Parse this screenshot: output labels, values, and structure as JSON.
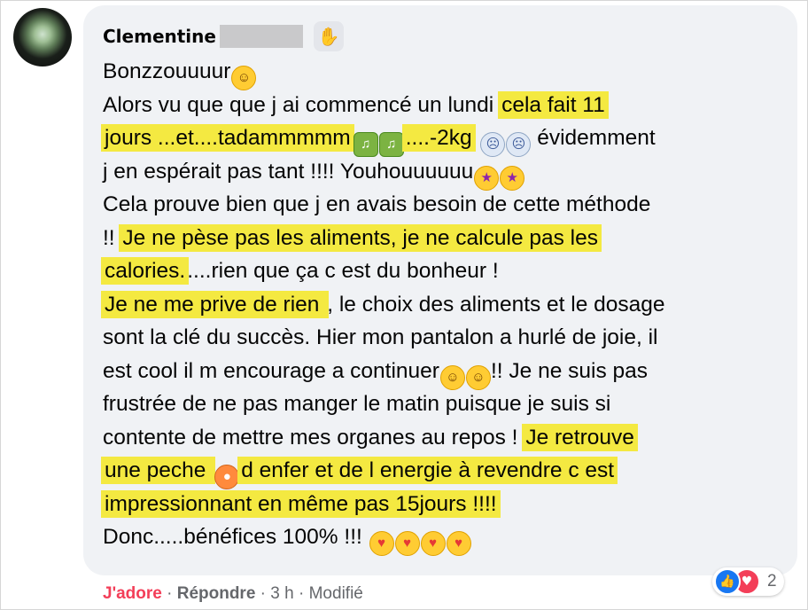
{
  "comment": {
    "author": "Clementine",
    "lines": [
      {
        "parts": [
          {
            "t": "Bonzzouuuur"
          },
          {
            "emoji": "grin"
          }
        ]
      },
      {
        "parts": [
          {
            "t": "Alors vu que que j ai commencé un lundi "
          },
          {
            "t": "cela fait 11",
            "hl": true
          }
        ]
      },
      {
        "parts": [
          {
            "t": "jours ...et....tadammmmm",
            "hl": true
          },
          {
            "emoji": "drum"
          },
          {
            "emoji": "drum"
          },
          {
            "t": "....-2kg",
            "hl": true
          },
          {
            "t": " "
          },
          {
            "emoji": "scream"
          },
          {
            "emoji": "scream"
          },
          {
            "t": " évidemment"
          }
        ]
      },
      {
        "parts": [
          {
            "t": "j en espérait pas tant !!!! Youhouuuuuu"
          },
          {
            "emoji": "star"
          },
          {
            "emoji": "star"
          }
        ]
      },
      {
        "parts": [
          {
            "t": "Cela prouve bien que j en avais besoin de cette méthode"
          }
        ]
      },
      {
        "parts": [
          {
            "t": "!! "
          },
          {
            "t": "Je ne pèse pas les aliments, je ne calcule pas les",
            "hl": true
          }
        ]
      },
      {
        "parts": [
          {
            "t": "calories.",
            "hl": true
          },
          {
            "t": "....rien que ça c est du bonheur !"
          }
        ]
      },
      {
        "parts": [
          {
            "t": "Je ne me prive de rien ",
            "hl": true
          },
          {
            "t": ", le choix des aliments et le dosage"
          }
        ]
      },
      {
        "parts": [
          {
            "t": "sont la clé du succès. Hier mon pantalon a hurlé de joie, il"
          }
        ]
      },
      {
        "parts": [
          {
            "t": "est cool il m encourage a continuer"
          },
          {
            "emoji": "laugh"
          },
          {
            "emoji": "laugh"
          },
          {
            "t": "!! Je ne suis pas"
          }
        ]
      },
      {
        "parts": [
          {
            "t": "frustrée de ne pas manger le matin puisque je suis si"
          }
        ]
      },
      {
        "parts": [
          {
            "t": "contente de mettre mes organes au repos ! "
          },
          {
            "t": "Je retrouve",
            "hl": true
          }
        ]
      },
      {
        "parts": [
          {
            "t": "une peche ",
            "hl": true
          },
          {
            "emoji": "peach"
          },
          {
            "t": "d enfer et de l energie à revendre c est",
            "hl": true
          }
        ]
      },
      {
        "parts": [
          {
            "t": "impressionnant en même pas 15jours !!!!",
            "hl": true
          }
        ]
      },
      {
        "parts": [
          {
            "t": "Donc.....bénéfices 100% !!! "
          },
          {
            "emoji": "heart"
          },
          {
            "emoji": "heart"
          },
          {
            "emoji": "heart"
          },
          {
            "emoji": "heart"
          }
        ]
      }
    ]
  },
  "actions": {
    "love_label": "J'adore",
    "sep1": " · ",
    "reply_label": "Répondre",
    "sep2": " · ",
    "time": "3 h",
    "sep3": " · ",
    "edited": "Modifié"
  },
  "reactions": {
    "count": "2",
    "types": [
      "like-icon",
      "love-icon"
    ]
  },
  "emoji_glyphs": {
    "grin": "☺",
    "drum": "♫",
    "scream": "☹",
    "star": "★",
    "laugh": "☺",
    "heart": "♥",
    "peach": "●"
  },
  "colors": {
    "highlight": "#f4e941",
    "bubble": "#f0f2f5",
    "love": "#f33e58",
    "like": "#1877f2",
    "meta": "#65676b"
  }
}
